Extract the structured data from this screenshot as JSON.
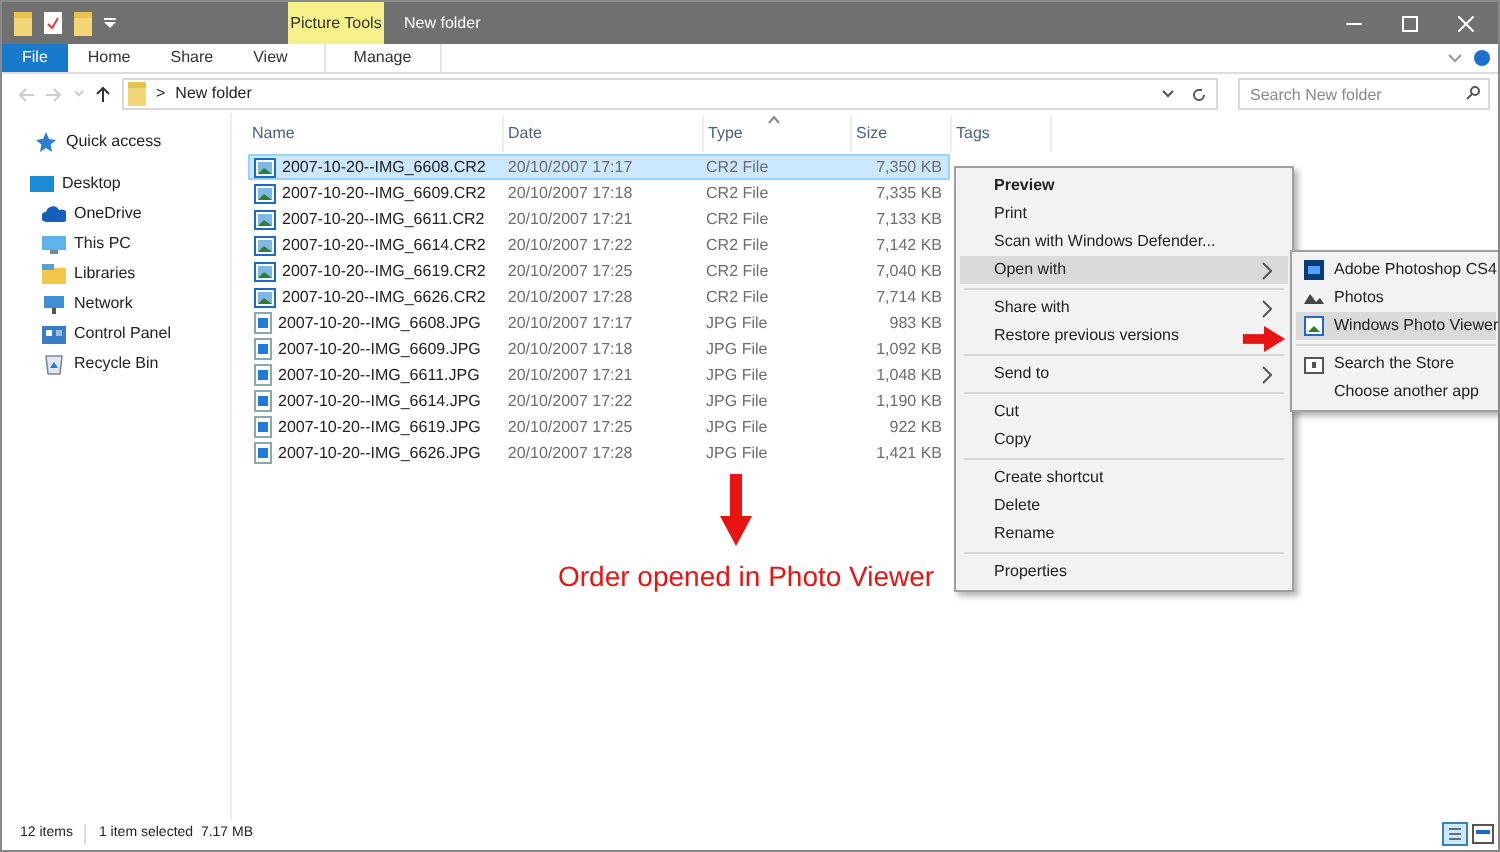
{
  "window": {
    "title": "New folder",
    "context_tab": "Picture Tools"
  },
  "ribbon_tabs": [
    {
      "label": "File",
      "kind": "file"
    },
    {
      "label": "Home",
      "kind": "tab"
    },
    {
      "label": "Share",
      "kind": "tab"
    },
    {
      "label": "View",
      "kind": "tab"
    },
    {
      "label": "Manage",
      "kind": "context"
    }
  ],
  "address": {
    "separator": ">",
    "path": "New folder"
  },
  "search": {
    "placeholder": "Search New folder"
  },
  "sidebar": {
    "items": [
      {
        "label": "Quick access"
      },
      {
        "label": "Desktop",
        "children": [
          {
            "label": "OneDrive"
          },
          {
            "label": "This PC"
          },
          {
            "label": "Libraries"
          },
          {
            "label": "Network"
          },
          {
            "label": "Control Panel"
          },
          {
            "label": "Recycle Bin"
          }
        ]
      }
    ]
  },
  "table": {
    "columns": [
      "Name",
      "Date",
      "Type",
      "Size",
      "Tags"
    ],
    "rows": [
      {
        "kind": "raw",
        "selected": true,
        "cells": [
          "2007-10-20--IMG_6608.CR2",
          "20/10/2007 17:17",
          "CR2 File",
          "7,350 KB"
        ]
      },
      {
        "kind": "raw",
        "selected": false,
        "cells": [
          "2007-10-20--IMG_6609.CR2",
          "20/10/2007 17:18",
          "CR2 File",
          "7,335 KB"
        ]
      },
      {
        "kind": "raw",
        "selected": false,
        "cells": [
          "2007-10-20--IMG_6611.CR2",
          "20/10/2007 17:21",
          "CR2 File",
          "7,133 KB"
        ]
      },
      {
        "kind": "raw",
        "selected": false,
        "cells": [
          "2007-10-20--IMG_6614.CR2",
          "20/10/2007 17:22",
          "CR2 File",
          "7,142 KB"
        ]
      },
      {
        "kind": "raw",
        "selected": false,
        "cells": [
          "2007-10-20--IMG_6619.CR2",
          "20/10/2007 17:25",
          "CR2 File",
          "7,040 KB"
        ]
      },
      {
        "kind": "raw",
        "selected": false,
        "cells": [
          "2007-10-20--IMG_6626.CR2",
          "20/10/2007 17:28",
          "CR2 File",
          "7,714 KB"
        ]
      },
      {
        "kind": "jpg",
        "selected": false,
        "cells": [
          "2007-10-20--IMG_6608.JPG",
          "20/10/2007 17:17",
          "JPG File",
          "983 KB"
        ]
      },
      {
        "kind": "jpg",
        "selected": false,
        "cells": [
          "2007-10-20--IMG_6609.JPG",
          "20/10/2007 17:18",
          "JPG File",
          "1,092 KB"
        ]
      },
      {
        "kind": "jpg",
        "selected": false,
        "cells": [
          "2007-10-20--IMG_6611.JPG",
          "20/10/2007 17:21",
          "JPG File",
          "1,048 KB"
        ]
      },
      {
        "kind": "jpg",
        "selected": false,
        "cells": [
          "2007-10-20--IMG_6614.JPG",
          "20/10/2007 17:22",
          "JPG File",
          "1,190 KB"
        ]
      },
      {
        "kind": "jpg",
        "selected": false,
        "cells": [
          "2007-10-20--IMG_6619.JPG",
          "20/10/2007 17:25",
          "JPG File",
          "922 KB"
        ]
      },
      {
        "kind": "jpg",
        "selected": false,
        "cells": [
          "2007-10-20--IMG_6626.JPG",
          "20/10/2007 17:28",
          "JPG File",
          "1,421 KB"
        ]
      }
    ]
  },
  "context_menu": {
    "groups": [
      [
        {
          "label": "Preview",
          "bold": true,
          "submenu": false,
          "selected": false
        },
        {
          "label": "Print",
          "bold": false,
          "submenu": false,
          "selected": false
        },
        {
          "label": "Scan with Windows Defender...",
          "bold": false,
          "submenu": false,
          "selected": false
        },
        {
          "label": "Open with",
          "bold": false,
          "submenu": true,
          "selected": true
        }
      ],
      [
        {
          "label": "Share with",
          "bold": false,
          "submenu": true,
          "selected": false
        },
        {
          "label": "Restore previous versions",
          "bold": false,
          "submenu": false,
          "selected": false
        }
      ],
      [
        {
          "label": "Send to",
          "bold": false,
          "submenu": true,
          "selected": false
        }
      ],
      [
        {
          "label": "Cut",
          "bold": false,
          "submenu": false,
          "selected": false
        },
        {
          "label": "Copy",
          "bold": false,
          "submenu": false,
          "selected": false
        }
      ],
      [
        {
          "label": "Create shortcut",
          "bold": false,
          "submenu": false,
          "selected": false
        },
        {
          "label": "Delete",
          "bold": false,
          "submenu": false,
          "selected": false
        },
        {
          "label": "Rename",
          "bold": false,
          "submenu": false,
          "selected": false
        }
      ],
      [
        {
          "label": "Properties",
          "bold": false,
          "submenu": false,
          "selected": false
        }
      ]
    ]
  },
  "submenu": {
    "groups": [
      [
        {
          "label": "Adobe Photoshop CS4",
          "selected": false
        },
        {
          "label": "Photos",
          "selected": false
        },
        {
          "label": "Windows Photo Viewer",
          "selected": true
        }
      ],
      [
        {
          "label": "Search the Store",
          "selected": false
        },
        {
          "label": "Choose another app",
          "selected": false
        }
      ]
    ]
  },
  "annotation": {
    "text": "Order opened in Photo Viewer"
  },
  "status_bar": {
    "count": "12 items",
    "selection": "1 item selected  7.17 MB"
  }
}
